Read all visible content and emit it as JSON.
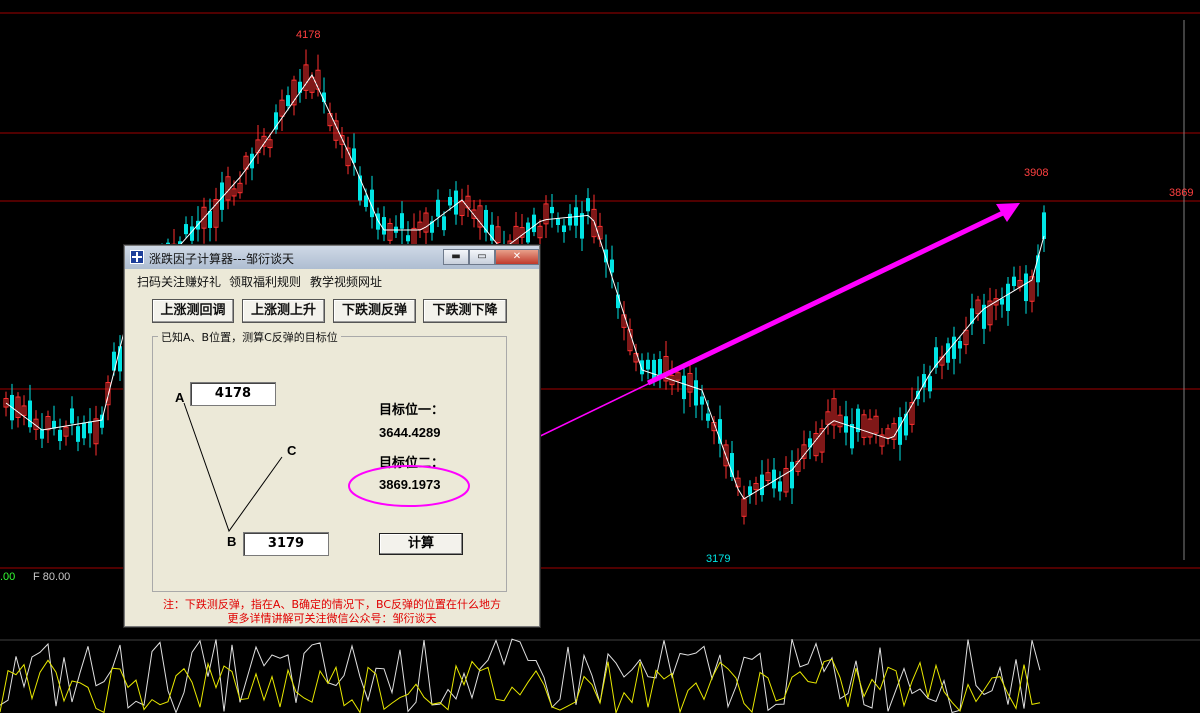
{
  "chart": {
    "price_high_label": "4178",
    "price_low_label": "3179",
    "price_recent_label": "3908",
    "target_level_label": "3869",
    "indicator_left": ".00",
    "indicator_f": "F 80.00",
    "colors": {
      "up": "#ff3030",
      "down": "#00e5e5",
      "ma": "#ffffff",
      "grid": "#a00000",
      "arrow": "#ff00ff",
      "indic_yellow": "#e8e800"
    }
  },
  "window": {
    "title": "涨跌因子计算器---邹衍谈天",
    "min_label": "▬",
    "max_label": "▭",
    "close_label": "✕",
    "menu": [
      "扫码关注赚好礼",
      "领取福利规则",
      "教学视频网址"
    ],
    "buttons": [
      "上涨测回调",
      "上涨测上升",
      "下跌测反弹",
      "下跌测下降"
    ],
    "group_label": "已知A、B位置，测算C反弹的目标位",
    "point_a": "A",
    "point_b": "B",
    "point_c": "C",
    "a_value": "4178",
    "b_value": "3179",
    "target1_label": "目标位一：",
    "target1_value": "3644.4289",
    "target2_label": "目标位二：",
    "target2_value": "3869.1973",
    "calc_label": "计算",
    "note_line1": "注：下跌测反弹，指在A、B确定的情况下，BC反弹的位置在什么地方",
    "note_line2": "更多详情讲解可关注微信公众号：邹衍谈天"
  }
}
